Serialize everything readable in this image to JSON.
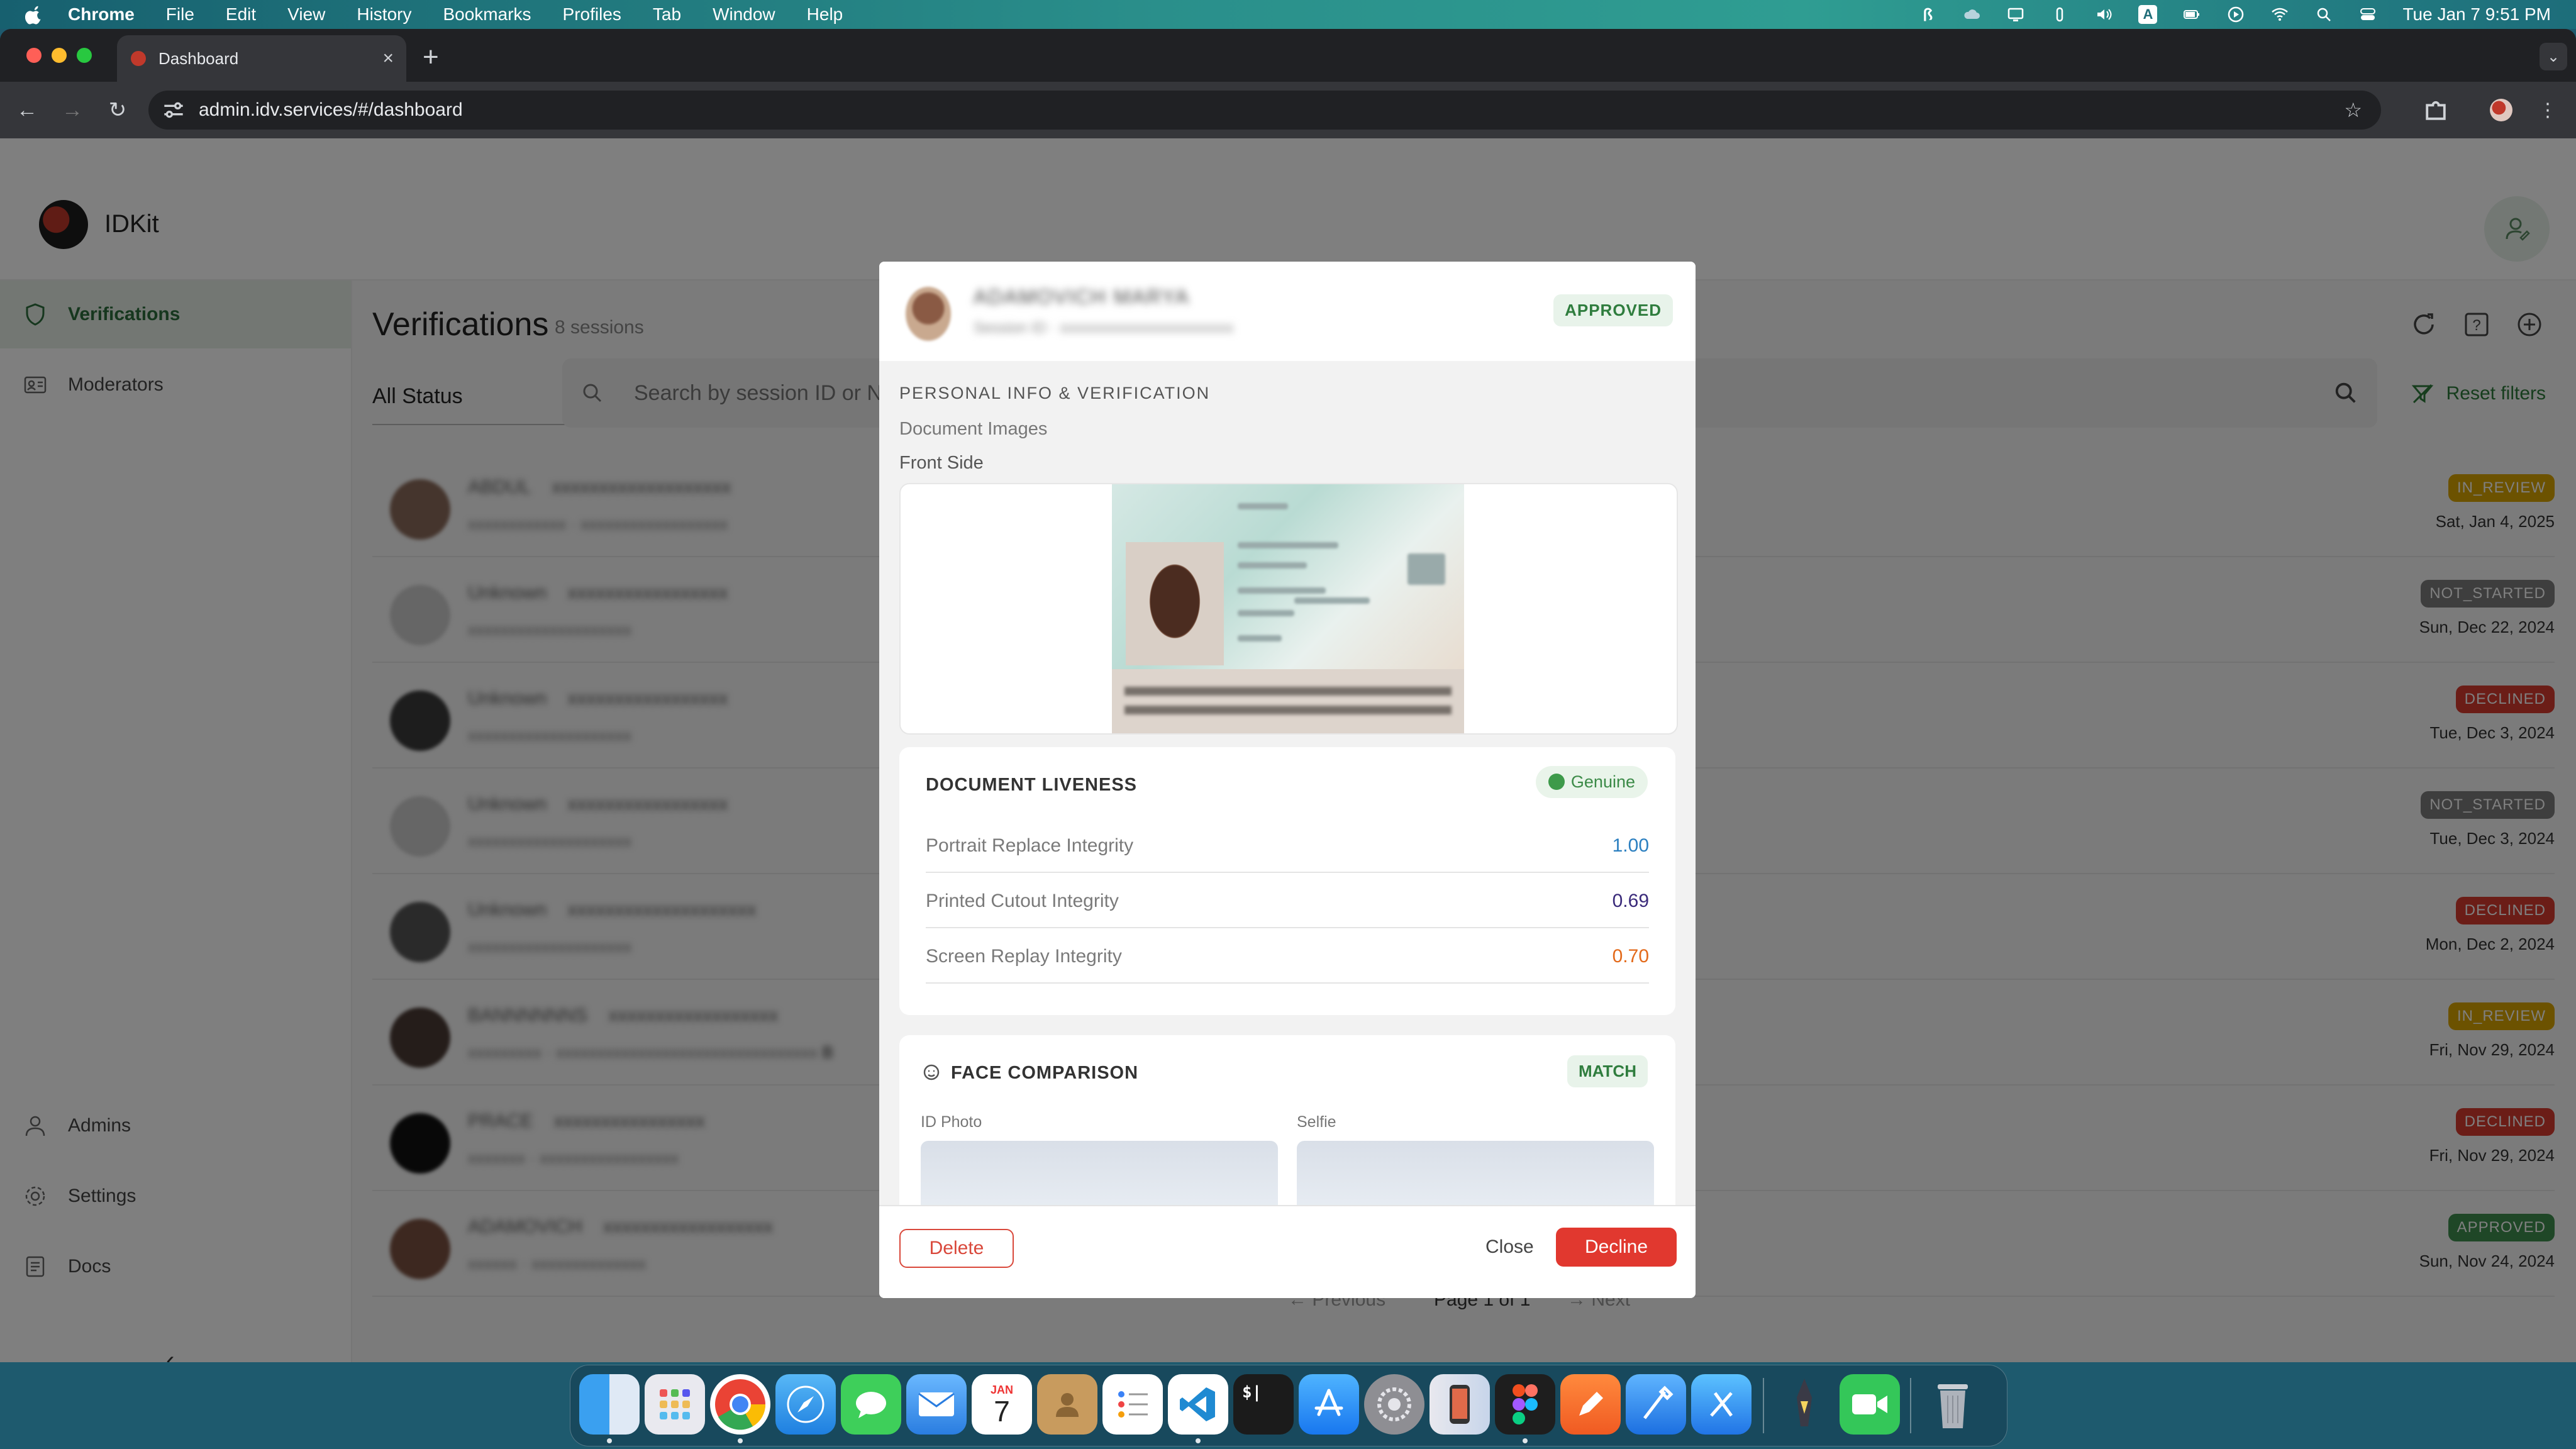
{
  "menubar": {
    "app": "Chrome",
    "items": [
      "File",
      "Edit",
      "View",
      "History",
      "Bookmarks",
      "Profiles",
      "Tab",
      "Window",
      "Help"
    ],
    "clock": "Tue Jan 7  9:51 PM"
  },
  "browser": {
    "tab_title": "Dashboard",
    "url": "admin.idv.services/#/dashboard"
  },
  "app": {
    "brand": "IDKit",
    "sidebar": {
      "top": [
        "Verifications",
        "Moderators"
      ],
      "bottom": [
        "Admins",
        "Settings",
        "Docs"
      ]
    },
    "page_title": "Verifications",
    "session_count": "8 sessions",
    "status_filter": "All Status",
    "search_placeholder": "Search by session ID or Na",
    "reset_filters": "Reset filters",
    "rows": [
      {
        "status": "IN_REVIEW",
        "date": "Sat, Jan 4, 2025"
      },
      {
        "status": "NOT_STARTED",
        "date": "Sun, Dec 22, 2024"
      },
      {
        "status": "DECLINED",
        "date": "Tue, Dec 3, 2024"
      },
      {
        "status": "NOT_STARTED",
        "date": "Tue, Dec 3, 2024"
      },
      {
        "status": "DECLINED",
        "date": "Mon, Dec 2, 2024"
      },
      {
        "status": "IN_REVIEW",
        "date": "Fri, Nov 29, 2024",
        "sub_tail": "B"
      },
      {
        "status": "DECLINED",
        "date": "Fri, Nov 29, 2024"
      },
      {
        "status": "APPROVED",
        "date": "Sun, Nov 24, 2024"
      }
    ],
    "pager": {
      "prev": "Previous",
      "info": "Page 1 of 1",
      "next": "Next"
    }
  },
  "modal": {
    "status": "APPROVED",
    "section_title": "PERSONAL INFO & VERIFICATION",
    "document_images": "Document Images",
    "front_side": "Front Side",
    "liveness": {
      "title": "DOCUMENT LIVENESS",
      "badge": "Genuine",
      "metrics": [
        {
          "name": "Portrait Replace Integrity",
          "value": "1.00",
          "color": "#2b7fc0"
        },
        {
          "name": "Printed Cutout Integrity",
          "value": "0.69",
          "color": "#3a2a7a"
        },
        {
          "name": "Screen Replay Integrity",
          "value": "0.70",
          "color": "#e36a1b"
        }
      ]
    },
    "face": {
      "title": "FACE COMPARISON",
      "badge": "MATCH",
      "id_photo": "ID Photo",
      "selfie": "Selfie"
    },
    "buttons": {
      "delete": "Delete",
      "close": "Close",
      "decline": "Decline"
    }
  },
  "colors": {
    "accent_green": "#2d7a3a",
    "in_review": "#d9a400",
    "not_started": "#7d7d7d",
    "declined": "#d63a2f",
    "approved": "#3e8e4f",
    "decline_button": "#e1382f"
  },
  "dock": {
    "calendar_month": "JAN",
    "calendar_day": "7"
  }
}
